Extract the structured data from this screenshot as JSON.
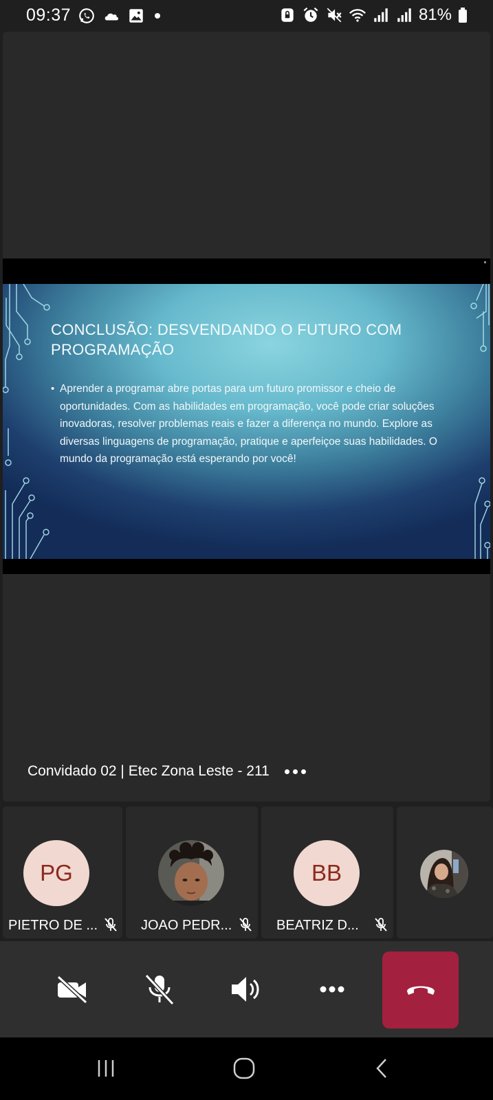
{
  "status_bar": {
    "time": "09:37",
    "battery": "81%",
    "left_icons": [
      "whatsapp-icon",
      "cloud-icon",
      "gallery-icon",
      "notification-dot-icon"
    ],
    "right_icons": [
      "lock-icon",
      "alarm-icon",
      "mute-icon",
      "wifi-icon",
      "signal-icon",
      "signal-icon",
      "battery-icon"
    ]
  },
  "shared_slide": {
    "title": "CONCLUSÃO: DESVENDANDO O FUTURO COM PROGRAMAÇÃO",
    "bullet": "•",
    "body": "Aprender a programar abre portas para um futuro promissor e cheio de oportunidades. Com as habilidades em programação, você pode criar soluções inovadoras, resolver problemas reais e fazer a diferença no mundo. Explore as diversas linguagens de programação, pratique e aperfeiçoe suas habilidades. O mundo da programação está esperando por você!"
  },
  "presenter": {
    "name": "Convidado 02 | Etec Zona Leste - 211",
    "more_icon": "more-horizontal-icon"
  },
  "participants": [
    {
      "initials": "PG",
      "name": "PIETRO DE ...",
      "avatar_type": "initials",
      "mic": "mic-off-icon"
    },
    {
      "initials": "",
      "name": "JOAO PEDR...",
      "avatar_type": "photo",
      "mic": "mic-off-icon"
    },
    {
      "initials": "BB",
      "name": "BEATRIZ D...",
      "avatar_type": "initials",
      "mic": "mic-off-icon"
    },
    {
      "initials": "",
      "name": "",
      "avatar_type": "photo",
      "mic": ""
    }
  ],
  "controls": {
    "camera": "camera-off-icon",
    "mic": "mic-off-icon",
    "speaker": "speaker-icon",
    "more": "more-horizontal-icon",
    "hangup": "hang-up-icon"
  },
  "navigation": {
    "recents": "recents-icon",
    "home": "home-icon",
    "back": "back-icon"
  },
  "colors": {
    "background": "#1f1f1f",
    "tile": "#292929",
    "controls": "#2f2f2f",
    "hangup": "#a4203f",
    "avatar_bg": "#f1d8d0",
    "avatar_text": "#8b2a1e"
  }
}
